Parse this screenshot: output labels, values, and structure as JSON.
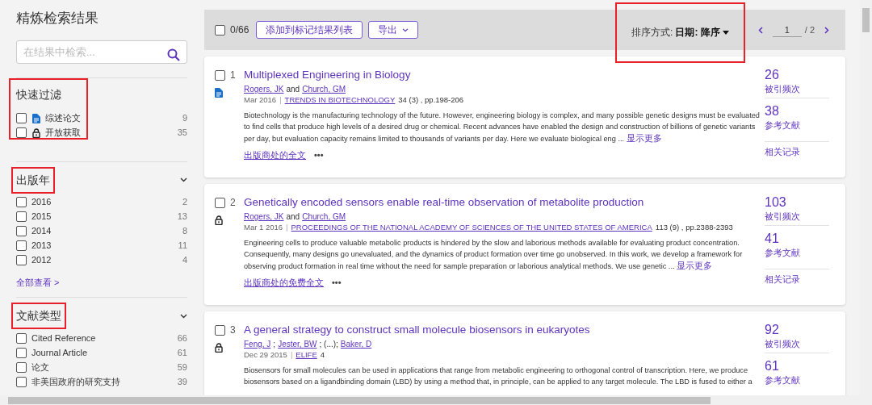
{
  "sidebar": {
    "title": "精炼检索结果",
    "search": {
      "placeholder": "在结果中检索..."
    },
    "sections": [
      {
        "kind": "quick",
        "title": "快速过滤",
        "highlighted": true,
        "items": [
          {
            "label": "综述论文",
            "count": "9",
            "checked": false,
            "kind": "review"
          },
          {
            "label": "开放获取",
            "count": "35",
            "checked": false,
            "kind": "open_access"
          }
        ]
      },
      {
        "kind": "list",
        "title": "出版年",
        "highlighted": true,
        "items": [
          {
            "label": "2016",
            "count": "2",
            "checked": false
          },
          {
            "label": "2015",
            "count": "13",
            "checked": false
          },
          {
            "label": "2014",
            "count": "8",
            "checked": false
          },
          {
            "label": "2013",
            "count": "11",
            "checked": false
          },
          {
            "label": "2012",
            "count": "4",
            "checked": false
          }
        ],
        "more": "全部查看 >"
      },
      {
        "kind": "list",
        "title": "文献类型",
        "highlighted": true,
        "items": [
          {
            "label": "Cited Reference",
            "count": "66",
            "checked": false
          },
          {
            "label": "Journal Article",
            "count": "61",
            "checked": false
          },
          {
            "label": "论文",
            "count": "59",
            "checked": false
          },
          {
            "label": "非美国政府的研究支持",
            "count": "39",
            "checked": false
          }
        ]
      }
    ]
  },
  "toolbar": {
    "select_all": {
      "checked": false,
      "label": "0/66"
    },
    "add_button": "添加到标记结果列表",
    "export_button": "导出",
    "sort": {
      "label": "排序方式:",
      "value": "日期: 降序",
      "highlighted": true
    },
    "page": {
      "current": "1",
      "total": "/ 2"
    }
  },
  "results": [
    {
      "number": "1",
      "checked": false,
      "kind": "review",
      "separator": "|",
      "title": "Multiplexed Engineering in Biology",
      "authors": [
        {
          "text": "Rogers, JK",
          "link": true
        },
        {
          "text": "and",
          "link": false
        },
        {
          "text": "Church, GM",
          "link": true
        }
      ],
      "date": "Mar 2016",
      "journal": "TRENDS IN BIOTECHNOLOGY",
      "volume": "34 (3) , pp.198-206",
      "abstract": "Biotechnology is the manufacturing technology of the future. However, engineering biology is complex, and many possible genetic designs must be evaluated to find cells that produce high levels of a desired drug or chemical. Recent advances have enabled the design and construction of billions of genetic variants per day, but evaluation capacity remains limited to thousands of variants per day. Here we evaluate biological eng ...",
      "show_more": "显示更多",
      "full_text": "出版商处的全文",
      "more": "•••",
      "citations": "26",
      "citations_label": "被引频次",
      "references": "38",
      "references_label": "参考文献",
      "related": "相关记录"
    },
    {
      "number": "2",
      "checked": false,
      "kind": "open_access",
      "separator": "|",
      "title": "Genetically encoded sensors enable real-time observation of metabolite production",
      "authors": [
        {
          "text": "Rogers, JK",
          "link": true
        },
        {
          "text": "and",
          "link": false
        },
        {
          "text": "Church, GM",
          "link": true
        }
      ],
      "date": "Mar 1 2016",
      "journal": "PROCEEDINGS OF THE NATIONAL ACADEMY OF SCIENCES OF THE UNITED STATES OF AMERICA",
      "volume": "113 (9) , pp.2388-2393",
      "abstract": "Engineering cells to produce valuable metabolic products is hindered by the slow and laborious methods available for evaluating product concentration. Consequently, many designs go unevaluated, and the dynamics of product formation over time go unobserved. In this work, we develop a framework for observing product formation in real time without the need for sample preparation or laborious analytical methods. We use genetic ...",
      "show_more": "显示更多",
      "full_text": "出版商处的免费全文",
      "more": "•••",
      "citations": "103",
      "citations_label": "被引频次",
      "references": "41",
      "references_label": "参考文献",
      "related": "相关记录"
    },
    {
      "number": "3",
      "checked": false,
      "kind": "open_access",
      "separator": "|",
      "title": "A general strategy to construct small molecule biosensors in eukaryotes",
      "authors": [
        {
          "text": "Feng, J",
          "link": true
        },
        {
          "text": ";",
          "link": false
        },
        {
          "text": "Jester, BW",
          "link": true
        },
        {
          "text": "; (...);",
          "link": false
        },
        {
          "text": "Baker, D",
          "link": true
        }
      ],
      "date": "Dec 29 2015",
      "journal": "ELIFE",
      "volume": "4",
      "abstract": "Biosensors for small molecules can be used in applications that range from metabolic engineering to orthogonal control of transcription. Here, we produce biosensors based on a ligandbinding domain (LBD) by using a method that, in principle, can be applied to any target molecule. The LBD is fused to either a",
      "citations": "92",
      "citations_label": "被引频次",
      "references": "61",
      "references_label": "参考文献"
    }
  ]
}
